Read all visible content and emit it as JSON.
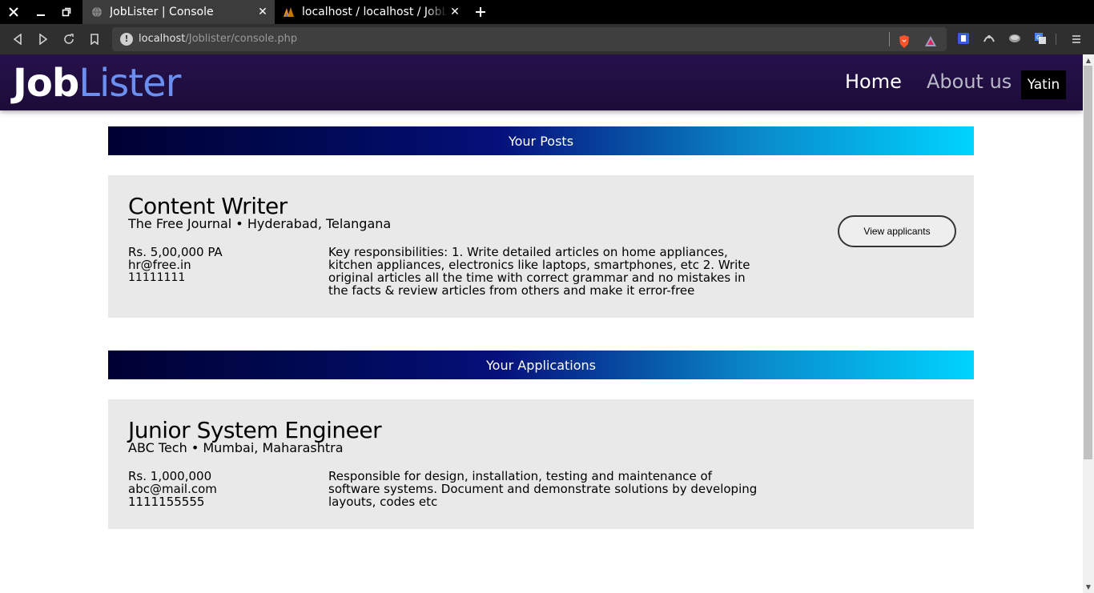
{
  "browser": {
    "tabs": [
      {
        "title": "JobLister | Console",
        "active": true,
        "icon": "globe-icon"
      },
      {
        "title": "localhost / localhost / JobLister",
        "active": false,
        "icon": "phpmyadmin-icon"
      }
    ],
    "url_host": "localhost",
    "url_path": "/Joblister/console.php"
  },
  "site": {
    "logo_part1": "Job",
    "logo_part2": "Lister",
    "nav": {
      "home": "Home",
      "about": "About us",
      "user": "Yatin"
    }
  },
  "posts": {
    "header": "Your Posts",
    "item": {
      "title": "Content Writer",
      "company_location": "The Free Journal • Hyderabad, Telangana",
      "salary": "Rs. 5,00,000 PA",
      "email": "hr@free.in",
      "phone": "11111111",
      "description": "Key responsibilities: 1. Write detailed articles on home appliances, kitchen appliances, electronics like laptops, smartphones, etc 2. Write original articles all the time with correct grammar and no mistakes in the facts & review articles from others and make it error-free",
      "button": "View applicants"
    }
  },
  "applications": {
    "header": "Your Applications",
    "item": {
      "title": "Junior System Engineer",
      "company_location": "ABC Tech • Mumbai, Maharashtra",
      "salary": "Rs. 1,000,000",
      "email": "abc@mail.com",
      "phone": "1111155555",
      "description": "Responsible for design, installation, testing and maintenance of software systems. Document and demonstrate solutions by developing layouts, codes etc"
    }
  },
  "colors": {
    "navbar": "#1f0e40",
    "logo_accent": "#6b8ff0",
    "card_bg": "#e9e9e9"
  }
}
